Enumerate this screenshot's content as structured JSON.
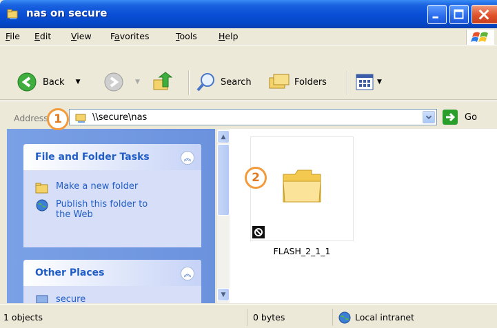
{
  "window": {
    "title": "nas on secure",
    "controls": {
      "minimize": "minimize-button",
      "maximize": "maximize-button",
      "close": "close-button"
    }
  },
  "menu": [
    {
      "pre": "",
      "ul": "F",
      "post": "ile"
    },
    {
      "pre": "",
      "ul": "E",
      "post": "dit"
    },
    {
      "pre": "",
      "ul": "V",
      "post": "iew"
    },
    {
      "pre": "F",
      "ul": "a",
      "post": "vorites"
    },
    {
      "pre": "",
      "ul": "T",
      "post": "ools"
    },
    {
      "pre": "",
      "ul": "H",
      "post": "elp"
    }
  ],
  "toolbar": {
    "back_label": "Back",
    "search_label": "Search",
    "folders_label": "Folders"
  },
  "address": {
    "label": "Address",
    "value": "\\\\secure\\nas",
    "go_label": "Go"
  },
  "left_pane": {
    "panels": [
      {
        "title": "File and Folder Tasks",
        "tasks": [
          "Make a new folder",
          "Publish this folder to the Web"
        ]
      },
      {
        "title": "Other Places",
        "tasks": [
          "secure"
        ]
      }
    ]
  },
  "content": {
    "items": [
      {
        "name": "FLASH_2_1_1",
        "type": "folder"
      }
    ]
  },
  "status": {
    "objects": "1 objects",
    "size": "0 bytes",
    "zone": "Local intranet"
  },
  "callouts": [
    "1",
    "2"
  ],
  "colors": {
    "titlebar": "#0A4FD6",
    "task_link": "#215DC6",
    "callout": "#F39A3C",
    "pane_bg": "#6B92DD"
  }
}
